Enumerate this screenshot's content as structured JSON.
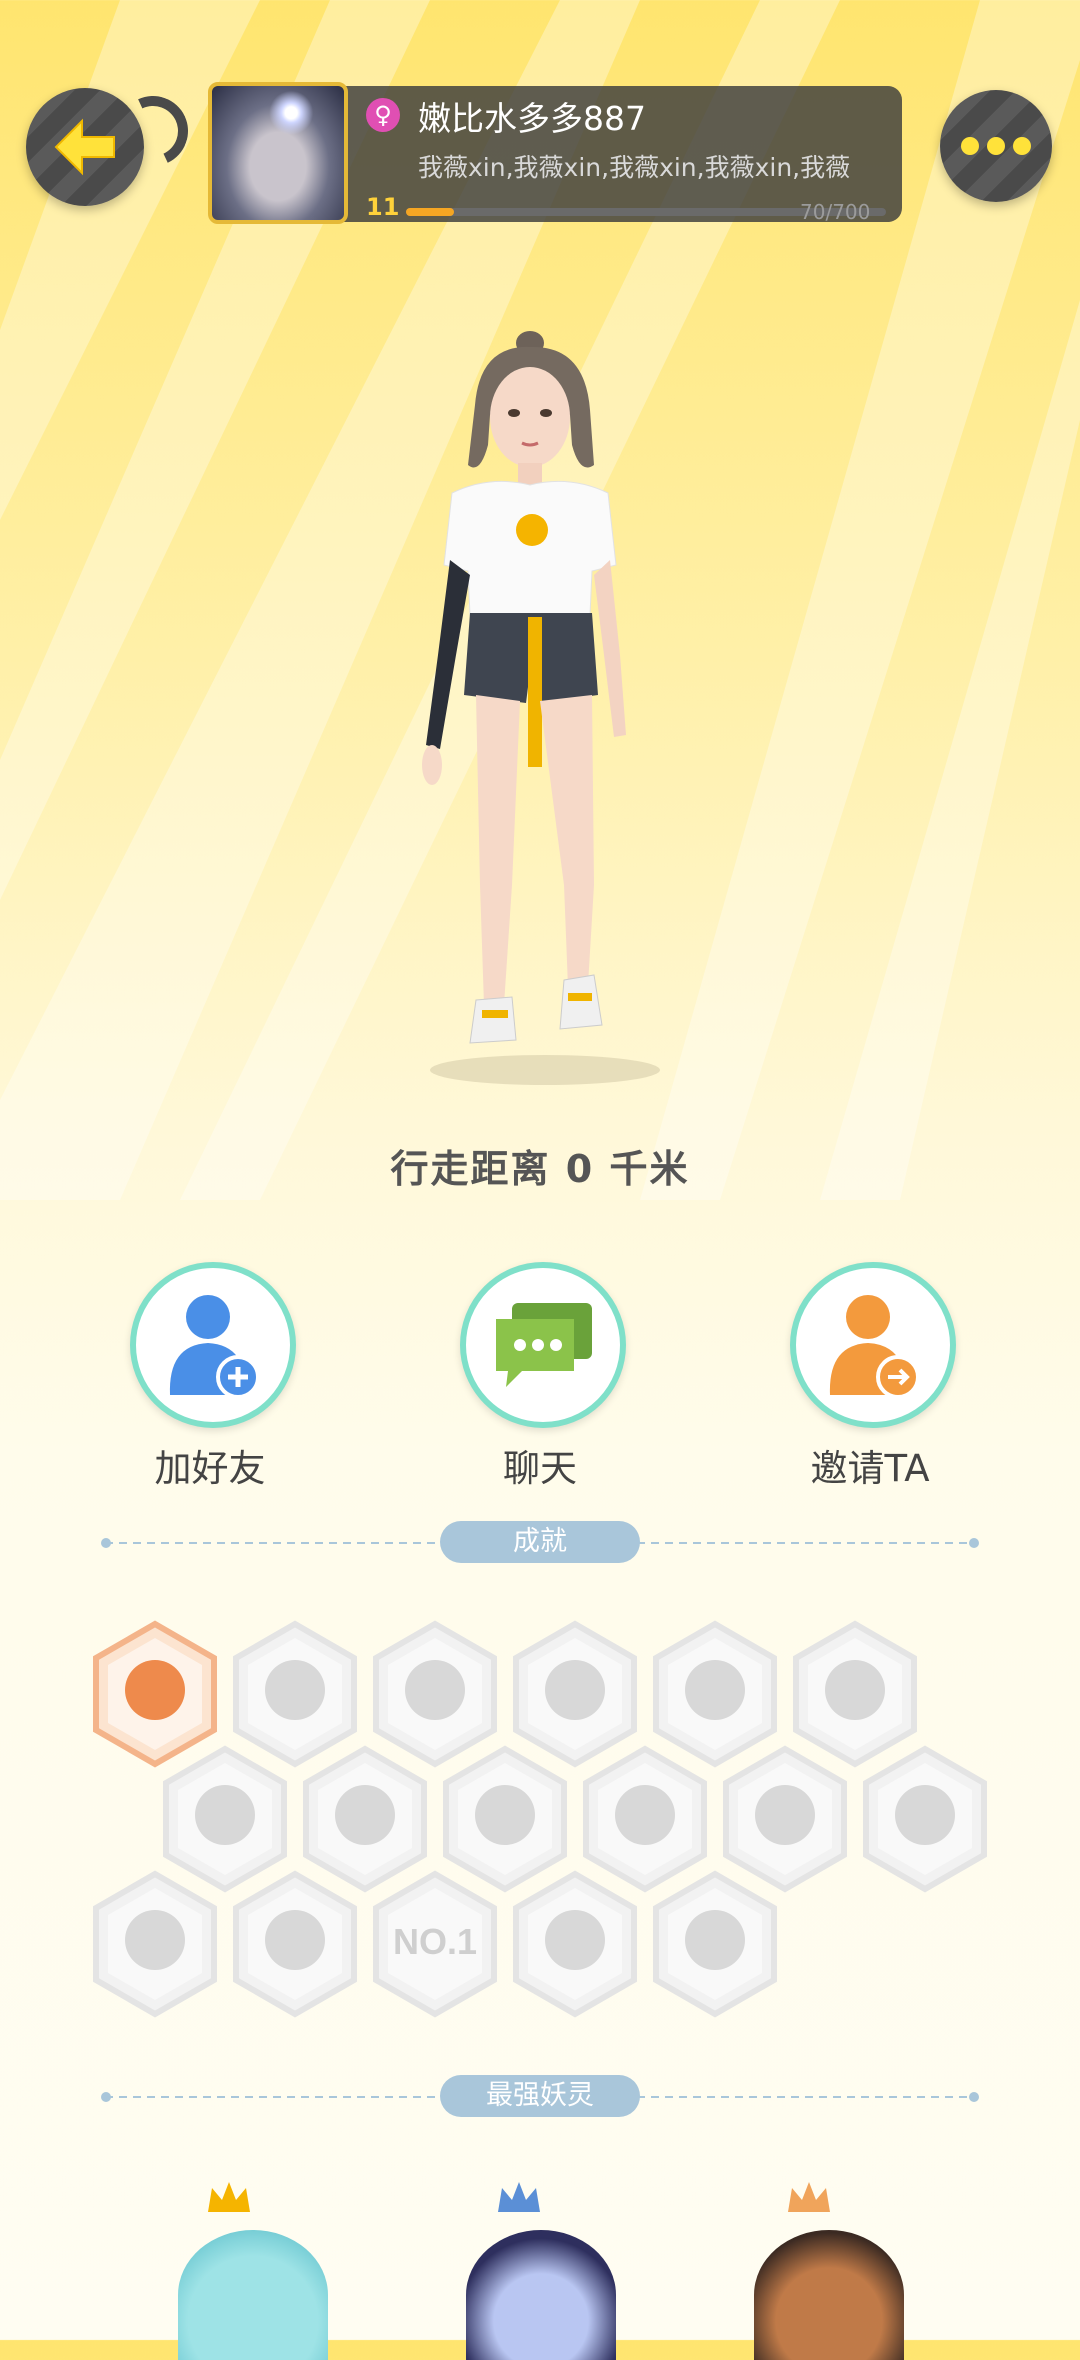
{
  "header": {
    "username": "嫩比水多多887",
    "signature": "我薇xin,我薇xin,我薇xin,我薇xin,我薇",
    "level": "11",
    "xp_text": "70/700",
    "xp_fraction": 0.1,
    "gender_symbol": "♀"
  },
  "icons": {
    "back": "back-arrow-icon",
    "more": "more-dots-icon"
  },
  "stats": {
    "distance": "行走距离 0 千米"
  },
  "actions": [
    {
      "label": "加好友",
      "icon": "add-friend-icon",
      "color": "#4A8FE7"
    },
    {
      "label": "聊天",
      "icon": "chat-icon",
      "color": "#8BC34A"
    },
    {
      "label": "邀请TA",
      "icon": "invite-icon",
      "color": "#F39A3D"
    }
  ],
  "sections": {
    "achievements": "成就",
    "strongest": "最强妖灵"
  },
  "achievements": [
    {
      "name": "cat-badge",
      "unlocked": true
    },
    {
      "name": "sneaker-badge",
      "unlocked": false
    },
    {
      "name": "target-badge",
      "unlocked": false
    },
    {
      "name": "moon-badge",
      "unlocked": false
    },
    {
      "name": "ball-badge",
      "unlocked": false
    },
    {
      "name": "crystal-badge",
      "unlocked": false
    },
    {
      "name": "taiji-swirl-badge",
      "unlocked": false
    },
    {
      "name": "fire-spirit-badge",
      "unlocked": false
    },
    {
      "name": "cart-badge",
      "unlocked": false
    },
    {
      "name": "spirit-badge",
      "unlocked": false
    },
    {
      "name": "taiji-book-badge",
      "unlocked": false
    },
    {
      "name": "dragon-badge",
      "unlocked": false
    },
    {
      "name": "shield-badge",
      "unlocked": false
    },
    {
      "name": "fox-book-badge",
      "unlocked": false
    },
    {
      "name": "no1-badge",
      "unlocked": false,
      "text": "NO.1"
    },
    {
      "name": "skull-belt-badge",
      "unlocked": false
    },
    {
      "name": "crossed-swords-badge",
      "unlocked": false
    }
  ],
  "colors": {
    "accent": "#FFE23A",
    "pill": "#A9C6DA",
    "ring": "#7FE0C9"
  }
}
